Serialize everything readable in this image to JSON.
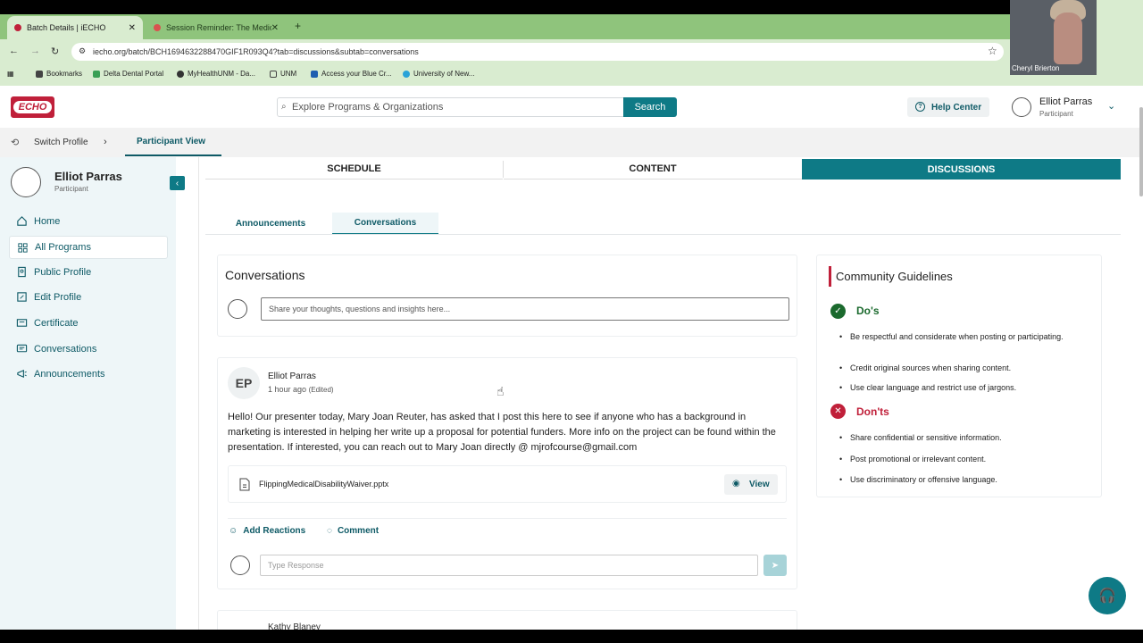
{
  "browser": {
    "tabs": [
      {
        "label": "Batch Details | iECHO",
        "active": true
      },
      {
        "label": "Session Reminder: The Medical...",
        "active": false
      }
    ],
    "url": "iecho.org/batch/BCH1694632288470GIF1R093Q4?tab=discussions&subtab=conversations",
    "bookmarks": [
      "Bookmarks",
      "Delta Dental Portal",
      "MyHealthUNM - Da...",
      "UNM",
      "Access your Blue Cr...",
      "University of New..."
    ]
  },
  "video": {
    "name": "Cheryl Brierton"
  },
  "header": {
    "logo_text": "ECHO",
    "search_placeholder": "Explore Programs & Organizations",
    "search_label": "Search",
    "help_label": "Help Center",
    "user_name": "Elliot Parras",
    "user_role": "Participant"
  },
  "subnav": {
    "switch_label": "Switch Profile",
    "view_label": "Participant View"
  },
  "sidebar": {
    "name": "Elliot Parras",
    "role": "Participant",
    "items": [
      {
        "label": "Home"
      },
      {
        "label": "All Programs"
      },
      {
        "label": "Public Profile"
      },
      {
        "label": "Edit Profile"
      },
      {
        "label": "Certificate"
      },
      {
        "label": "Conversations"
      },
      {
        "label": "Announcements"
      }
    ]
  },
  "tabs": [
    "SCHEDULE",
    "CONTENT",
    "DISCUSSIONS"
  ],
  "subtabs": [
    "Announcements",
    "Conversations"
  ],
  "conversations": {
    "title": "Conversations",
    "input_placeholder": "Share your thoughts, questions and insights here...",
    "post": {
      "initials": "EP",
      "author": "Elliot Parras",
      "time": "1 hour ago",
      "edited": "(Edited)",
      "body": "Hello! Our presenter today, Mary Joan Reuter, has asked that I post this here to see if anyone who has a background in marketing is interested in helping her write up a proposal for potential funders. More info on the project can be found within the presentation. If interested, you can reach out to Mary Joan directly @ mjrofcourse@gmail.com",
      "attachment": "FlippingMedicalDisabilityWaiver.pptx",
      "view_label": "View",
      "reactions_label": "Add Reactions",
      "comment_label": "Comment",
      "response_placeholder": "Type Response"
    },
    "next_author": "Kathy Blaney"
  },
  "guidelines": {
    "title": "Community Guidelines",
    "dos_title": "Do's",
    "dos": [
      "Be respectful and considerate when posting or participating.",
      "Credit original sources when sharing content.",
      "Use clear language and restrict use of jargons."
    ],
    "donts_title": "Don'ts",
    "donts": [
      "Share confidential or sensitive information.",
      "Post promotional or irrelevant content.",
      "Use discriminatory or offensive language."
    ]
  },
  "colors": {
    "accent": "#0e7a86",
    "brand_red": "#c0203a",
    "do_green": "#1b6a2e"
  }
}
